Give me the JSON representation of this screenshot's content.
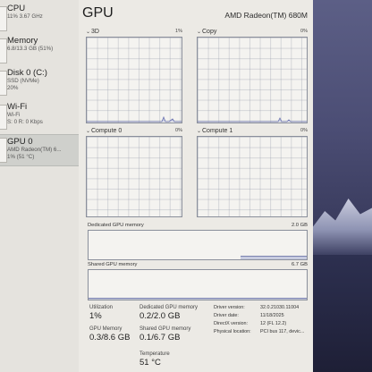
{
  "sidebar": {
    "items": [
      {
        "label": "CPU",
        "line1": "11% 3.67 GHz",
        "line2": ""
      },
      {
        "label": "Memory",
        "line1": "6.8/13.3 GB (51%)",
        "line2": ""
      },
      {
        "label": "Disk 0 (C:)",
        "line1": "SSD (NVMe)",
        "line2": "20%"
      },
      {
        "label": "Wi-Fi",
        "line1": "Wi-Fi",
        "line2": "S: 0 R: 0 Kbps"
      },
      {
        "label": "GPU 0",
        "line1": "AMD Radeon(TM) 6...",
        "line2": "1% (51 °C)"
      }
    ]
  },
  "header": {
    "title": "GPU",
    "adapter": "AMD Radeon(TM) 680M"
  },
  "engines": [
    {
      "name": "3D",
      "percent": "1%"
    },
    {
      "name": "Copy",
      "percent": "0%"
    },
    {
      "name": "Compute 0",
      "percent": "0%"
    },
    {
      "name": "Compute 1",
      "percent": "0%"
    }
  ],
  "dedicated": {
    "label": "Dedicated GPU memory",
    "max": "2.0 GB"
  },
  "shared": {
    "label": "Shared GPU memory",
    "max": "6.7 GB",
    "level": 0.04
  },
  "stats": {
    "utilization": {
      "label": "Utilization",
      "value": "1%"
    },
    "ded_mem": {
      "label": "Dedicated GPU memory",
      "value": "0.2/2.0 GB"
    },
    "gpu_mem": {
      "label": "GPU Memory",
      "value": "0.3/8.6 GB"
    },
    "shared_mem": {
      "label": "Shared GPU memory",
      "value": "0.1/6.7 GB"
    },
    "temperature": {
      "label": "Temperature",
      "value": "51 °C"
    }
  },
  "details": [
    {
      "key": "Driver version:",
      "value": "32.0.21030.11004"
    },
    {
      "key": "Driver date:",
      "value": "11/18/2025"
    },
    {
      "key": "DirectX version:",
      "value": "12 (FL 12.2)"
    },
    {
      "key": "Physical location:",
      "value": "PCI bus 117, devic..."
    }
  ],
  "icons": {
    "chevron": "chevron-down-icon"
  }
}
